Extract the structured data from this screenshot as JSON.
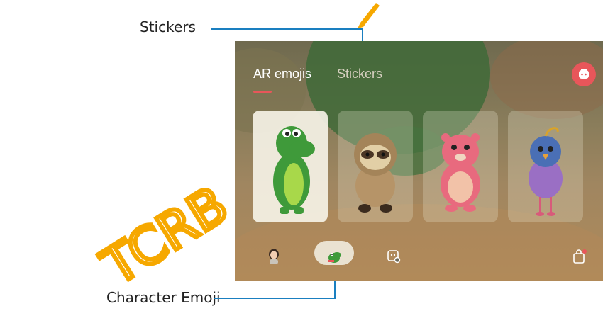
{
  "callouts": {
    "stickers": "Stickers",
    "character_emoji": "Character Emoji"
  },
  "watermark": "TCRB",
  "tabs": [
    {
      "label": "AR emojis",
      "selected": true
    },
    {
      "label": "Stickers",
      "selected": false
    }
  ],
  "characters": [
    {
      "name": "green-dinosaur",
      "selected": true
    },
    {
      "name": "sloth",
      "selected": false
    },
    {
      "name": "pink-beaver",
      "selected": false
    },
    {
      "name": "purple-bird",
      "selected": false
    }
  ],
  "bottom_bar": {
    "icons": [
      "my-emoji-icon",
      "character-emoji-icon",
      "sticker-camera-icon",
      "shop-icon"
    ],
    "selected": "character-emoji-icon"
  },
  "colors": {
    "accent": "#e8565a",
    "callout_line": "#1a7fc0",
    "watermark": "#f6a800",
    "tab_active": "#ffffff",
    "tab_inactive": "#d6d0c0"
  }
}
